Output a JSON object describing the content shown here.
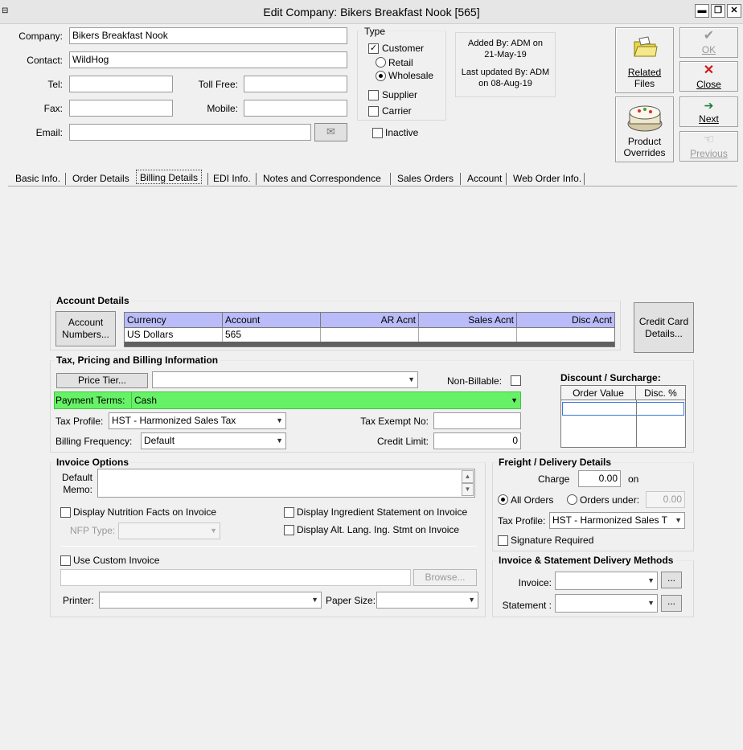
{
  "window": {
    "title": "Edit Company: Bikers Breakfast Nook [565]",
    "sys_icon": "window-icon",
    "minimize": "▬",
    "restore": "❐",
    "close": "✕"
  },
  "company": {
    "company_label": "Company:",
    "company_value": "Bikers Breakfast Nook",
    "contact_label": "Contact:",
    "contact_value": "WildHog",
    "tel_label": "Tel:",
    "tel_value": "",
    "tollfree_label": "Toll Free:",
    "tollfree_value": "",
    "fax_label": "Fax:",
    "fax_value": "",
    "mobile_label": "Mobile:",
    "mobile_value": "",
    "email_label": "Email:",
    "email_value": ""
  },
  "type": {
    "title": "Type",
    "customer": "Customer",
    "customer_checked": true,
    "retail": "Retail",
    "wholesale": "Wholesale",
    "selected": "Wholesale",
    "supplier": "Supplier",
    "carrier": "Carrier",
    "inactive": "Inactive"
  },
  "audit": {
    "added_line1": "Added By: ADM on",
    "added_line2": "21-May-19",
    "updated_line1": "Last updated By: ADM",
    "updated_line2": "on 08-Aug-19"
  },
  "toolbar": {
    "related_line1": "Related",
    "related_line2": "Files",
    "overrides_line1": "Product",
    "overrides_line2": "Overrides",
    "ok": "OK",
    "close": "Close",
    "next": "Next",
    "previous": "Previous"
  },
  "tabs": [
    "Basic Info.",
    "Order Details",
    "Billing Details",
    "EDI Info.",
    "Notes and Correspondence",
    "Sales Orders",
    "Account",
    "Web Order Info."
  ],
  "active_tab": "Billing Details",
  "account_details": {
    "title": "Account Details",
    "numbers_btn_line1": "Account",
    "numbers_btn_line2": "Numbers...",
    "columns": [
      "Currency",
      "Account",
      "AR Acnt",
      "Sales Acnt",
      "Disc Acnt"
    ],
    "rows": [
      [
        "US Dollars",
        "565",
        "",
        "",
        ""
      ]
    ],
    "credit_card_line1": "Credit Card",
    "credit_card_line2": "Details..."
  },
  "tax_pricing": {
    "title": "Tax, Pricing and Billing Information",
    "price_tier_btn": "Price Tier...",
    "price_tier_value": "",
    "non_billable": "Non-Billable:",
    "payment_terms_label": "Payment Terms:",
    "payment_terms_value": "Cash",
    "tax_profile_label": "Tax Profile:",
    "tax_profile_value": "HST - Harmonized Sales Tax",
    "tax_exempt_label": "Tax Exempt No:",
    "tax_exempt_value": "",
    "billing_freq_label": "Billing Frequency:",
    "billing_freq_value": "Default",
    "credit_limit_label": "Credit Limit:",
    "credit_limit_value": "0",
    "discount_title": "Discount / Surcharge:",
    "discount_columns": [
      "Order Value",
      "Disc. %"
    ]
  },
  "invoice_options": {
    "title": "Invoice Options",
    "memo_label_line1": "Default",
    "memo_label_line2": "Memo:",
    "memo_value": "",
    "nutrition": "Display Nutrition Facts on Invoice",
    "ingredient": "Display Ingredient Statement on Invoice",
    "nfp_label": "NFP Type:",
    "nfp_value": "",
    "alt_lang": "Display Alt. Lang. Ing. Stmt on Invoice",
    "custom_invoice": "Use Custom Invoice",
    "custom_path": "",
    "browse_btn": "Browse...",
    "printer_label": "Printer:",
    "printer_value": "",
    "paper_label": "Paper Size:",
    "paper_value": ""
  },
  "freight": {
    "title": "Freight / Delivery Details",
    "charge_label": "Charge",
    "charge_value": "0.00",
    "on_label": "on",
    "all_orders": "All Orders",
    "orders_under": "Orders under:",
    "orders_under_value": "0.00",
    "selected": "All Orders",
    "tax_profile_label": "Tax Profile:",
    "tax_profile_value": "HST - Harmonized Sales T",
    "signature": "Signature Required"
  },
  "delivery_methods": {
    "title": "Invoice & Statement Delivery Methods",
    "invoice_label": "Invoice:",
    "invoice_value": "",
    "statement_label": "Statement :",
    "statement_value": "",
    "ellipsis": "..."
  },
  "colors": {
    "payment_highlight": "#66f266",
    "grid_header": "#b9bcf8"
  }
}
